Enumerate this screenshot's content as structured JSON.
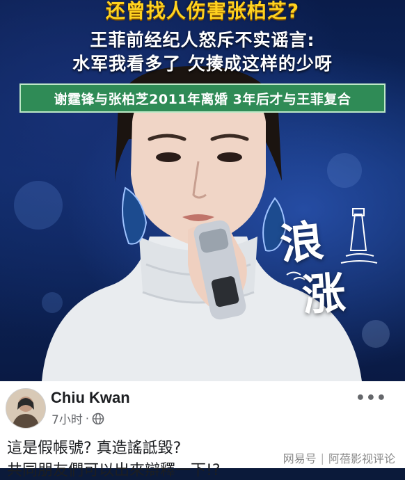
{
  "video": {
    "headline_1": "还曾找人伤害张柏芝?",
    "headline_2": "王菲前经纪人怒斥不实谣言:",
    "headline_3": "水军我看多了 欠揍成这样的少呀",
    "banner": "谢霆锋与张柏芝2011年离婚 3年后才与王菲复合",
    "show_logo": [
      "浪",
      "涨"
    ]
  },
  "post": {
    "author": "Chiu Kwan",
    "time": "7小时",
    "dot": "·",
    "more": "•••",
    "line_1": "這是假帳號? 真造謠詆毀?",
    "line_2": "共同朋友們可以出來辯釋一下!?"
  },
  "watermark": {
    "left": "网易号",
    "separator": "|",
    "right": "阿蓓影视评论"
  },
  "colors": {
    "headline_yellow": "#ffd21f",
    "banner_green": "#2f8b56",
    "bg_blue": "#0d2a66"
  }
}
